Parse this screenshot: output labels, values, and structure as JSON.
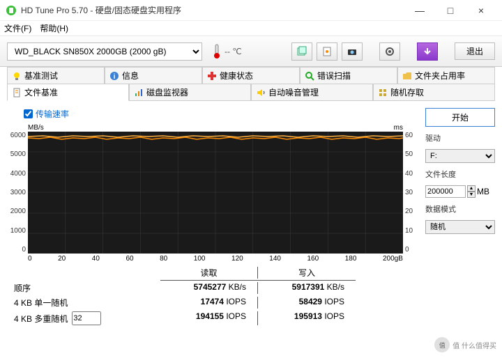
{
  "window": {
    "title": "HD Tune Pro 5.70 - 硬盘/固态硬盘实用程序",
    "min": "—",
    "max": "□",
    "close": "×"
  },
  "menu": {
    "file": "文件(F)",
    "help": "帮助(H)"
  },
  "toolbar": {
    "drive": "WD_BLACK SN850X 2000GB (2000 gB)",
    "temp": "-- ℃",
    "exit": "退出"
  },
  "tabs": {
    "row1": {
      "benchmark": "基准测试",
      "info": "信息",
      "health": "健康状态",
      "error": "错误扫描",
      "folder": "文件夹占用率"
    },
    "row2": {
      "file": "文件基准",
      "monitor": "磁盘监视器",
      "aam": "自动噪音管理",
      "random": "随机存取"
    }
  },
  "checkbox": {
    "transfer": "传输速率"
  },
  "side": {
    "start": "开始",
    "drive_lbl": "驱动",
    "drive_val": "F:",
    "len_lbl": "文件长度",
    "len_val": "200000",
    "len_unit": "MB",
    "mode_lbl": "数据模式",
    "mode_val": "随机"
  },
  "chart_data": {
    "type": "line",
    "title": "",
    "xlabel": "gB",
    "ylabel_left": "MB/s",
    "ylabel_right": "ms",
    "xlim": [
      0,
      200
    ],
    "ylim_left": [
      0,
      6000
    ],
    "ylim_right": [
      0,
      60
    ],
    "xticks": [
      0,
      20,
      40,
      60,
      80,
      100,
      120,
      140,
      160,
      180,
      200
    ],
    "yticks_left": [
      0,
      1000,
      2000,
      3000,
      4000,
      5000,
      6000
    ],
    "yticks_right": [
      0,
      10,
      20,
      30,
      40,
      50,
      60
    ],
    "series": [
      {
        "name": "read_speed",
        "unit": "MB/s",
        "approx": 5745,
        "color": "#ff8c00"
      },
      {
        "name": "write_speed",
        "unit": "MB/s",
        "approx": 5917,
        "color": "#ffa500"
      }
    ]
  },
  "results": {
    "read_hdr": "读取",
    "write_hdr": "写入",
    "unit_kbs": "KB/s",
    "unit_iops": "IOPS",
    "rows": [
      {
        "label": "顺序",
        "read": "5745277",
        "write": "5917391",
        "unit": "KB/s"
      },
      {
        "label": "4 KB 单一随机",
        "read": "17474",
        "write": "58429",
        "unit": "IOPS"
      },
      {
        "label": "4 KB 多重随机",
        "spin": "32",
        "read": "194155",
        "write": "195913",
        "unit": "IOPS"
      }
    ]
  },
  "watermark": "值  什么值得买"
}
